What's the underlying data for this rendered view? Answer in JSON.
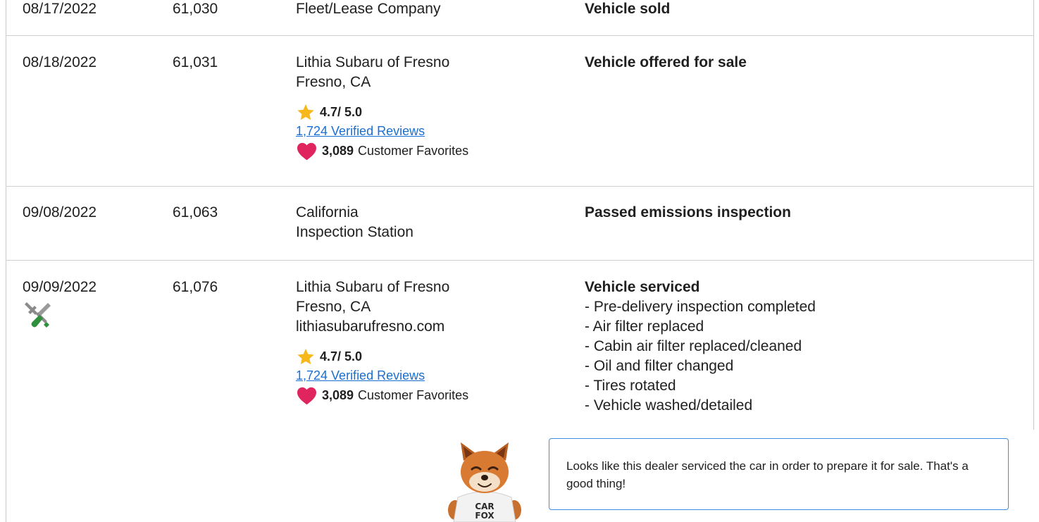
{
  "records": [
    {
      "date": "08/17/2022",
      "mileage": "61,030",
      "source_lines": [
        "Fleet/Lease Company"
      ],
      "comment_title": "Vehicle sold"
    },
    {
      "date": "08/18/2022",
      "mileage": "61,031",
      "source_lines": [
        "Lithia Subaru of Fresno",
        "Fresno, CA"
      ],
      "rating": "4.7/ 5.0",
      "reviews_link": "1,724 Verified Reviews",
      "favorites_count": "3,089",
      "favorites_label": "Customer Favorites",
      "comment_title": "Vehicle offered for sale"
    },
    {
      "date": "09/08/2022",
      "mileage": "61,063",
      "source_lines": [
        "California",
        "Inspection Station"
      ],
      "comment_title": "Passed emissions inspection"
    },
    {
      "date": "09/09/2022",
      "mileage": "61,076",
      "icon": "wrench-screwdriver-icon",
      "source_lines": [
        "Lithia Subaru of Fresno",
        "Fresno, CA",
        "lithiasubarufresno.com"
      ],
      "rating": "4.7/ 5.0",
      "reviews_link": "1,724 Verified Reviews",
      "favorites_count": "3,089",
      "favorites_label": "Customer Favorites",
      "comment_title": "Vehicle serviced",
      "comment_items": [
        "- Pre-delivery inspection completed",
        "- Air filter replaced",
        "- Cabin air filter replaced/cleaned",
        "- Oil and filter changed",
        "- Tires rotated",
        "- Vehicle washed/detailed"
      ]
    }
  ],
  "tip": {
    "text": "Looks like this dealer serviced the car in order to prepare it for sale. That's a good thing!",
    "mascot_shirt": "CAR FOX"
  },
  "colors": {
    "link": "#1a6fd1",
    "star": "#f6b81c",
    "heart": "#e0245e",
    "tip_border": "#3f8ee0",
    "divider": "#cfcfcf"
  }
}
